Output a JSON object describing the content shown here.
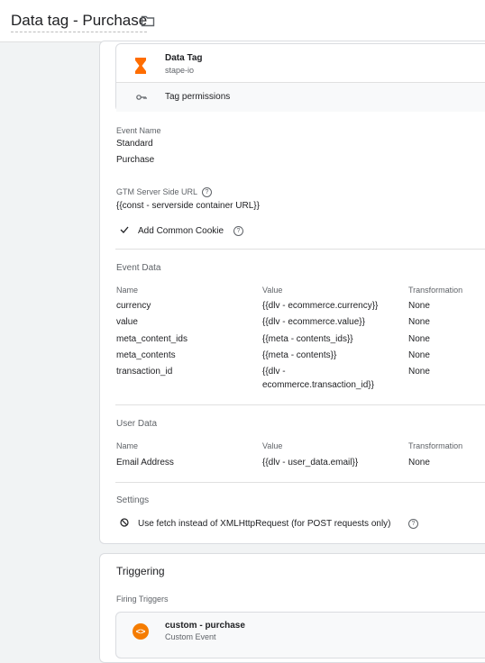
{
  "header": {
    "title": "Data tag - Purchase",
    "folder_icon": "folder-icon"
  },
  "tag": {
    "name": "Data Tag",
    "vendor": "stape-io",
    "permissions_label": "Tag permissions",
    "brand_color": "#ff6d00"
  },
  "event": {
    "label": "Event Name",
    "type": "Standard",
    "value": "Purchase"
  },
  "gtm": {
    "label": "GTM Server Side URL",
    "value": "{{const - serverside container URL}}",
    "common_cookie_label": "Add Common Cookie"
  },
  "event_data": {
    "title": "Event Data",
    "headers": [
      "Name",
      "Value",
      "Transformation"
    ],
    "rows": [
      {
        "name": "currency",
        "value": "{{dlv - ecommerce.currency}}",
        "transform": "None"
      },
      {
        "name": "value",
        "value": "{{dlv - ecommerce.value}}",
        "transform": "None"
      },
      {
        "name": "meta_content_ids",
        "value": "{{meta - contents_ids}}",
        "transform": "None"
      },
      {
        "name": "meta_contents",
        "value": "{{meta - contents}}",
        "transform": "None"
      },
      {
        "name": "transaction_id",
        "value_line1": "{{dlv -",
        "value_line2": "ecommerce.transaction_id}}",
        "transform": "None"
      }
    ]
  },
  "user_data": {
    "title": "User Data",
    "headers": [
      "Name",
      "Value",
      "Transformation"
    ],
    "rows": [
      {
        "name": "Email Address",
        "value": "{{dlv - user_data.email}}",
        "transform": "None"
      }
    ]
  },
  "settings": {
    "title": "Settings",
    "item": "Use fetch instead of XMLHttpRequest (for POST requests only)"
  },
  "triggering": {
    "title": "Triggering",
    "firing_label": "Firing Triggers",
    "trigger_name": "custom - purchase",
    "trigger_type": "Custom Event",
    "trigger_color": "#f57c00"
  }
}
